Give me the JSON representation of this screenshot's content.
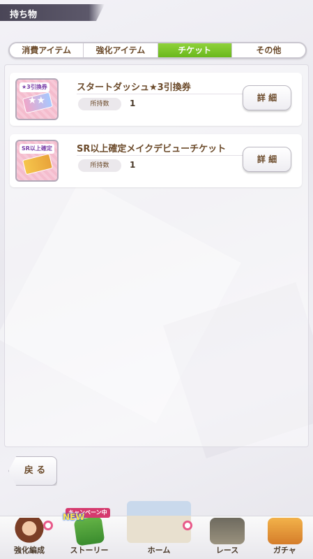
{
  "screen": {
    "title": "持ち物"
  },
  "tabs": [
    {
      "label": "消費アイテム",
      "active": false
    },
    {
      "label": "強化アイテム",
      "active": false
    },
    {
      "label": "チケット",
      "active": true
    },
    {
      "label": "その他",
      "active": false
    }
  ],
  "items": [
    {
      "icon_tag": "★3引換券",
      "icon": "star-ticket-icon",
      "name": "スタートダッシュ★3引換券",
      "qty_label": "所持数",
      "qty": "1",
      "detail_label": "詳 細"
    },
    {
      "icon_tag": "SR以上確定",
      "icon": "gold-ticket-icon",
      "name": "SR以上確定メイクデビューチケット",
      "qty_label": "所持数",
      "qty": "1",
      "detail_label": "詳 細"
    }
  ],
  "back": {
    "label": "戻 る"
  },
  "bottom_nav": {
    "campaign_badge": "キャンペーン中",
    "new_badge": "NEW",
    "items": [
      {
        "label": "強化編成",
        "icon": "horse-girl-icon"
      },
      {
        "label": "ストーリー",
        "icon": "story-book-icon"
      },
      {
        "label": "ホーム",
        "icon": "home-building-icon"
      },
      {
        "label": "レース",
        "icon": "race-gate-icon"
      },
      {
        "label": "ガチャ",
        "icon": "gacha-icon"
      }
    ]
  },
  "colors": {
    "active_tab": "#7ac428",
    "text_brown": "#6b4a2a",
    "notice_pink": "#e85a8a"
  }
}
